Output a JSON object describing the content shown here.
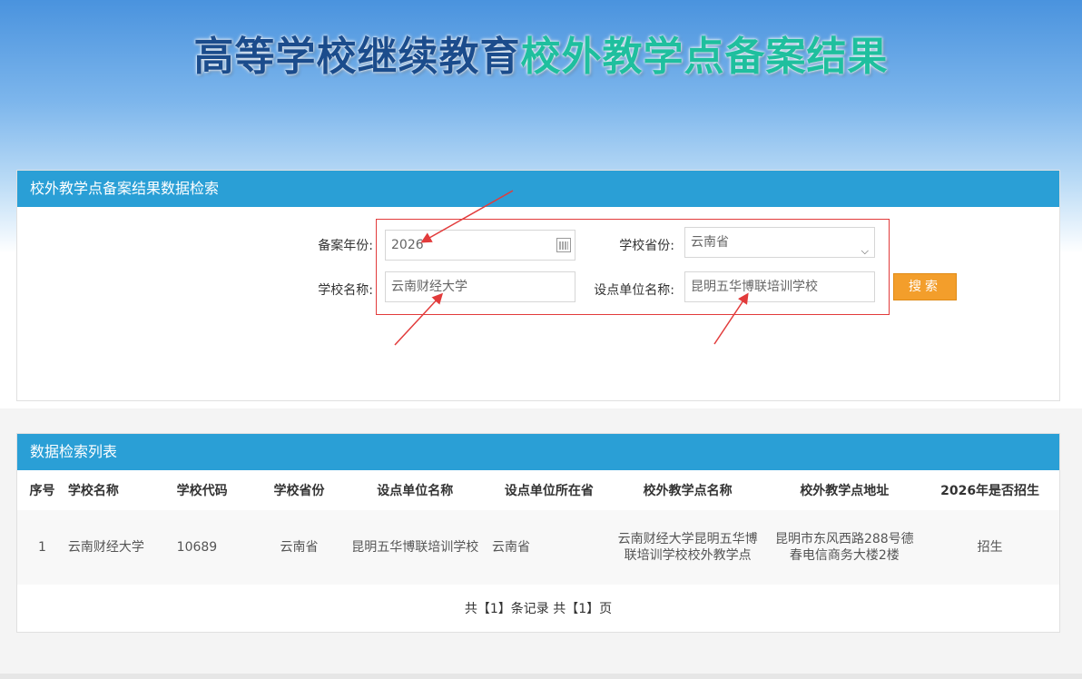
{
  "header": {
    "title_part1": "高等学校继续教育",
    "title_part2": "校外教学点备案结果"
  },
  "search": {
    "panel_title": "校外教学点备案结果数据检索",
    "year_label": "备案年份:",
    "year_value": "2026",
    "province_label": "学校省份:",
    "province_value": "云南省",
    "school_label": "学校名称:",
    "school_value": "云南财经大学",
    "unit_label": "设点单位名称:",
    "unit_value": "昆明五华博联培训学校",
    "search_button": "搜索",
    "accent_color": "#e23b3b"
  },
  "list": {
    "panel_title": "数据检索列表",
    "columns": [
      "序号",
      "学校名称",
      "学校代码",
      "学校省份",
      "设点单位名称",
      "设点单位所在省",
      "校外教学点名称",
      "校外教学点地址",
      "2026年是否招生"
    ],
    "rows": [
      [
        "1",
        "云南财经大学",
        "10689",
        "云南省",
        "昆明五华博联培训学校",
        "云南省",
        "云南财经大学昆明五华博联培训学校校外教学点",
        "昆明市东风西路288号德春电信商务大楼2楼",
        "招生"
      ]
    ],
    "pager": "共【1】条记录 共【1】页"
  },
  "colors": {
    "header_bar": "#2a9fd6",
    "button": "#f39e2b",
    "title_dark": "#1b4c8c",
    "title_green": "#1fbf9e"
  }
}
